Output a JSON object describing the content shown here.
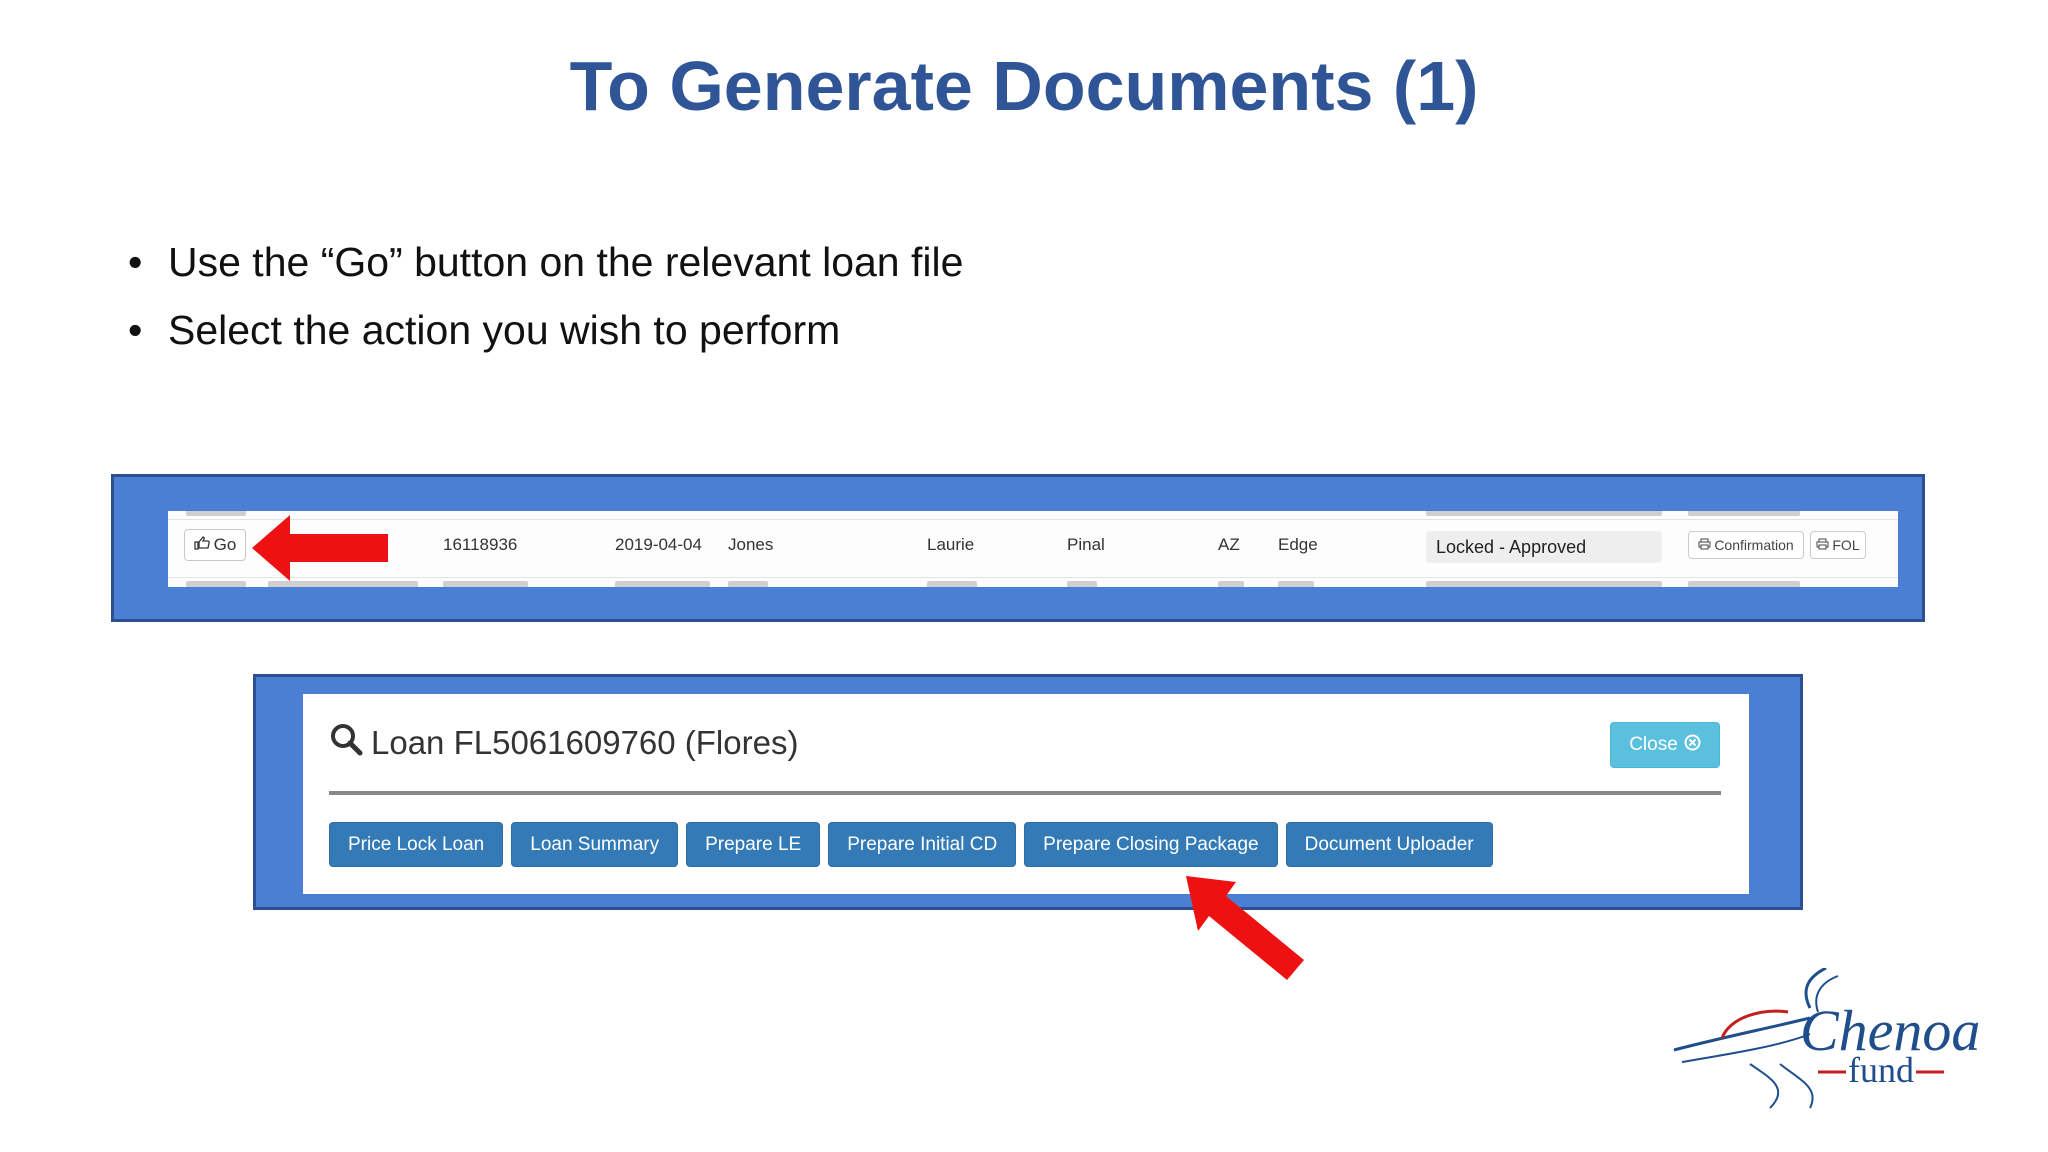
{
  "slide": {
    "title": "To Generate Documents (1)",
    "bullets": [
      "Use the “Go” button on the relevant loan file",
      "Select the action you wish to perform"
    ]
  },
  "loan_row": {
    "go_label": "Go",
    "loan_number": "16118936",
    "date": "2019-04-04",
    "last_name": "Jones",
    "first_name": "Laurie",
    "county": "Pinal",
    "state": "AZ",
    "product": "Edge",
    "status": "Locked - Approved",
    "confirmation_label": "Confirmation",
    "fol_label": "FOL"
  },
  "loan_modal": {
    "title": "Loan FL5061609760 (Flores)",
    "close_label": "Close",
    "actions": [
      "Price Lock Loan",
      "Loan Summary",
      "Prepare LE",
      "Prepare Initial CD",
      "Prepare Closing Package",
      "Document Uploader"
    ]
  },
  "logo": {
    "name_top": "Chenoa",
    "name_bottom": "fund"
  },
  "colors": {
    "title_blue": "#2f5597",
    "panel_blue": "#4a7fd4",
    "primary_button": "#337ab7",
    "info_button": "#5bc0de",
    "arrow_red": "#ee1111"
  },
  "icons": {
    "go": "hand-point-icon",
    "search": "search-icon",
    "close": "close-circle-icon",
    "print": "print-icon"
  }
}
